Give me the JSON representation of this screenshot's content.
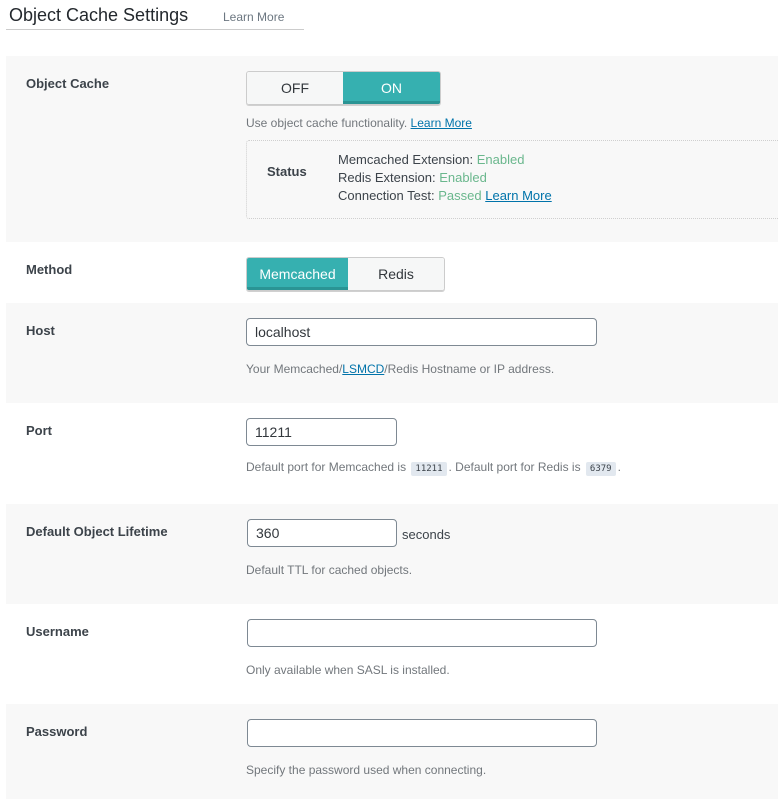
{
  "header": {
    "title": "Object Cache Settings",
    "learn_more": "Learn More"
  },
  "object_cache": {
    "label": "Object Cache",
    "toggle": {
      "off": "OFF",
      "on": "ON",
      "selected": "ON"
    },
    "desc": "Use object cache functionality.",
    "desc_link": "Learn More",
    "status": {
      "label": "Status",
      "lines": [
        {
          "key": "Memcached Extension:",
          "value": "Enabled"
        },
        {
          "key": "Redis Extension:",
          "value": "Enabled"
        },
        {
          "key": "Connection Test:",
          "value": "Passed",
          "link": "Learn More"
        }
      ]
    }
  },
  "method": {
    "label": "Method",
    "options": [
      "Memcached",
      "Redis"
    ],
    "selected": "Memcached"
  },
  "host": {
    "label": "Host",
    "value": "localhost",
    "desc_pre": "Your Memcached/",
    "desc_link": "LSMCD",
    "desc_post": "/Redis Hostname or IP address."
  },
  "port": {
    "label": "Port",
    "value": "11211",
    "desc_1": "Default port for Memcached is",
    "code_1": "11211",
    "desc_2": ". Default port for Redis is",
    "code_2": "6379",
    "desc_3": "."
  },
  "lifetime": {
    "label": "Default Object Lifetime",
    "value": "360",
    "suffix": "seconds",
    "desc": "Default TTL for cached objects."
  },
  "username": {
    "label": "Username",
    "value": "",
    "desc": "Only available when SASL is installed."
  },
  "password": {
    "label": "Password",
    "value": "",
    "desc": "Specify the password used when connecting."
  },
  "colors": {
    "accent": "#36b0b0",
    "enabled": "#6ab78d",
    "link": "#0073aa"
  }
}
